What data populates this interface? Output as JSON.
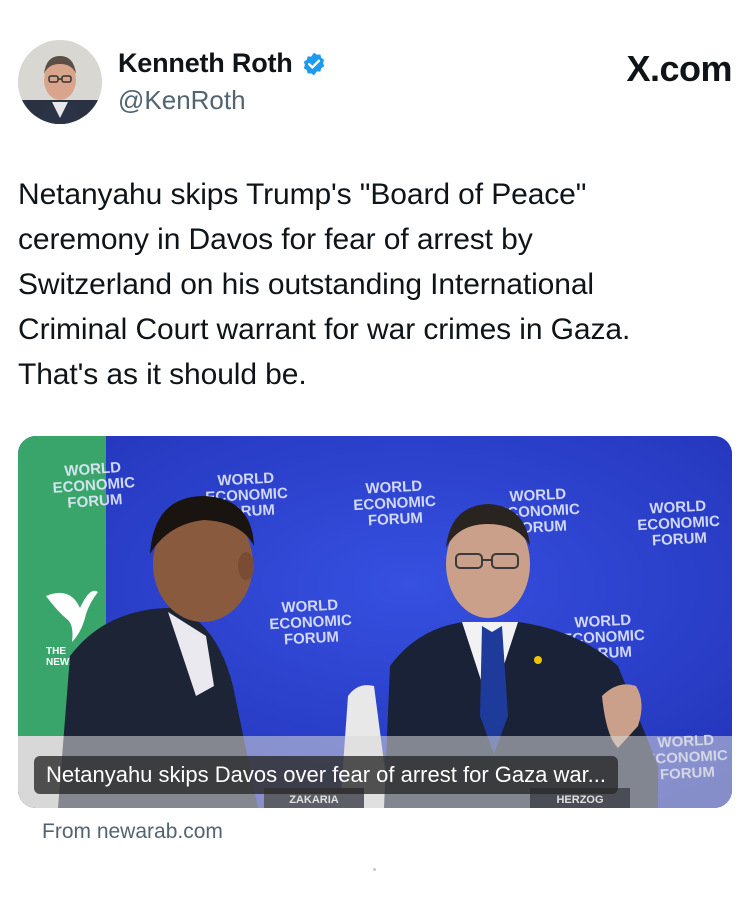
{
  "author": {
    "name": "Kenneth Roth",
    "handle": "@KenRoth",
    "verified": true,
    "avatar_icon": "profile-photo"
  },
  "brand": "X.com",
  "tweet": {
    "lines": [
      "Netanyahu skips Trump's \"Board of Peace\"",
      "ceremony in Davos for fear of arrest by",
      "Switzerland on his outstanding International",
      "Criminal Court warrant for war crimes in Gaza.",
      "That's as it should be."
    ]
  },
  "card": {
    "caption": "Netanyahu skips Davos over fear of arrest for Gaza war...",
    "source": "From newarab.com",
    "image": {
      "backdrop_text": [
        "WORLD",
        "ECONOMIC",
        "FORUM"
      ],
      "watermark_line1": "THE",
      "watermark_line2": "NEWARAB",
      "nameplate_left": "ZAKARIA",
      "nameplate_right": "HERZOG",
      "backdrop_color": "#2b3fd0",
      "accent_green": "#3aa56a"
    }
  },
  "colors": {
    "text": "#0f1419",
    "secondary": "#536471",
    "verified_blue": "#1d9bf0"
  }
}
